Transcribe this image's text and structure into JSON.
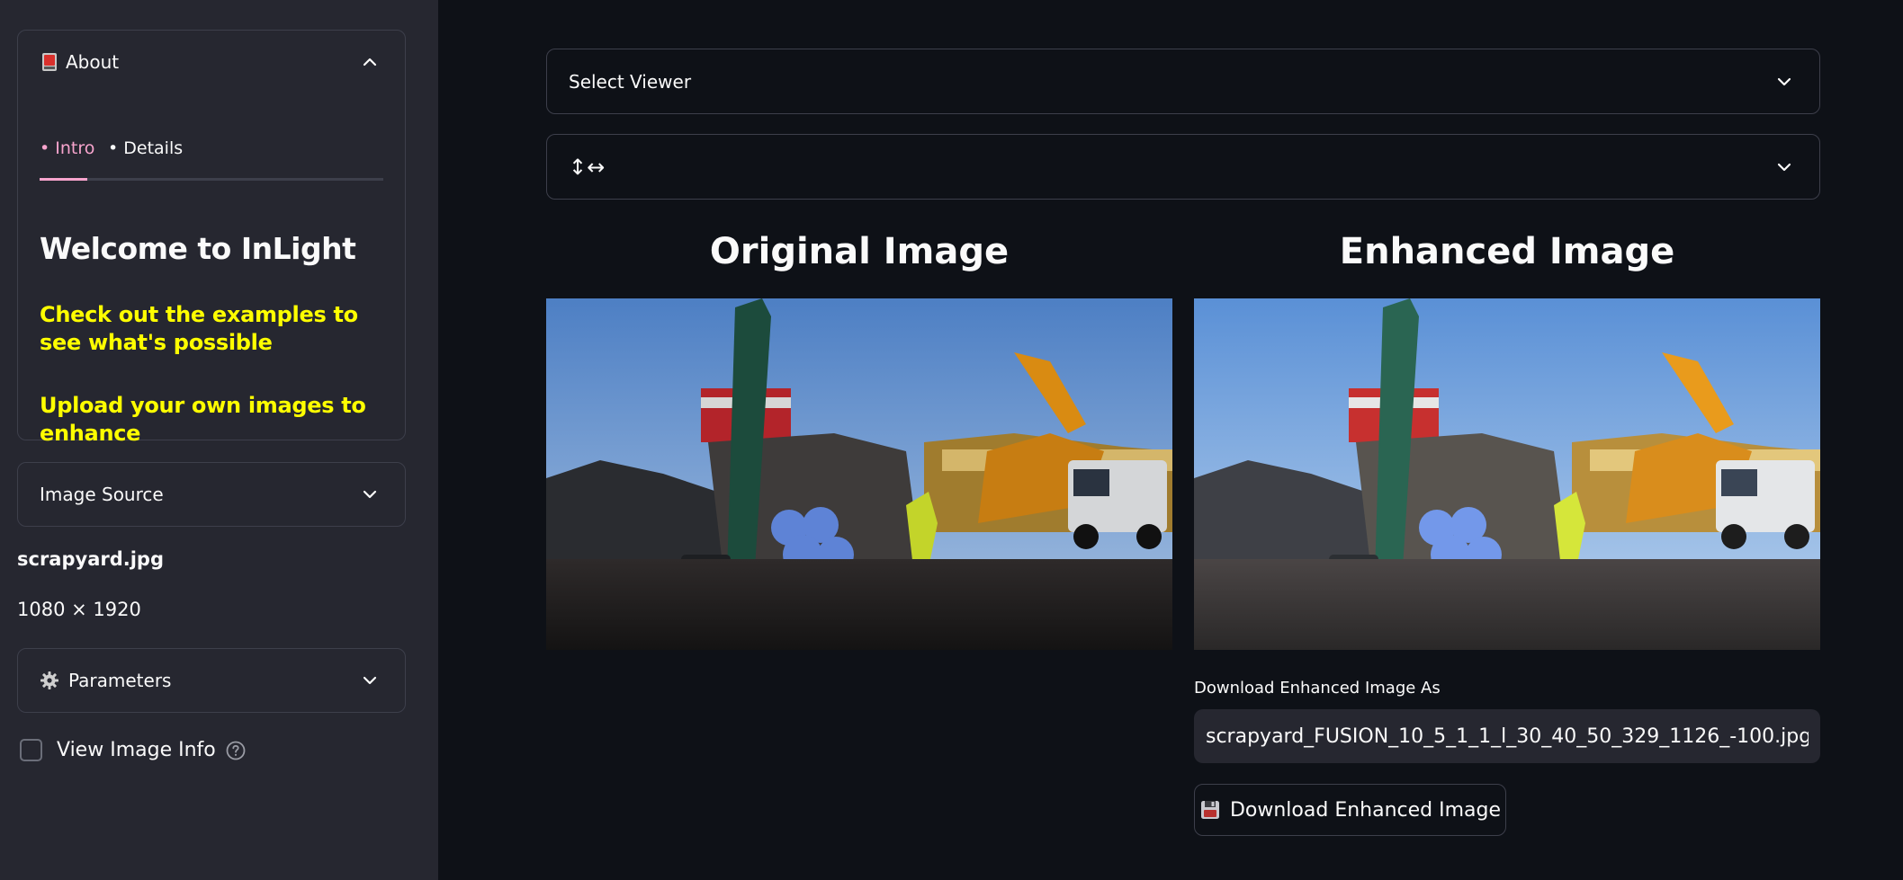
{
  "sidebar": {
    "about": {
      "icon": "red-card-icon",
      "title": "About",
      "tabs": [
        {
          "label": "• Intro"
        },
        {
          "label": "• Details"
        }
      ],
      "heading": "Welcome to InLight",
      "lines": [
        "Check out the examples to see what's possible",
        "Upload your own images to enhance"
      ]
    },
    "image_source": {
      "title": "Image Source"
    },
    "file": {
      "name": "scrapyard.jpg",
      "dimensions": "1080 × 1920"
    },
    "parameters": {
      "icon": "gear-icon",
      "title": "Parameters"
    },
    "view_info": {
      "label": "View Image Info",
      "checked": false
    }
  },
  "main": {
    "viewer_select": {
      "value": "Select Viewer"
    },
    "orientation_select": {
      "value": "↕↔"
    },
    "original": {
      "title": "Original Image"
    },
    "enhanced": {
      "title": "Enhanced Image"
    },
    "download": {
      "label": "Download Enhanced Image As",
      "filename": "scrapyard_FUSION_10_5_1_1_l_30_40_50_329_1126_-100.jpg",
      "button_label": "Download Enhanced Image",
      "button_icon": "floppy-disk-icon"
    }
  },
  "colors": {
    "background": "#0e1117",
    "sidebar": "#262730",
    "accent_pink": "#f7a4cd",
    "highlight_yellow": "#ffff00"
  }
}
